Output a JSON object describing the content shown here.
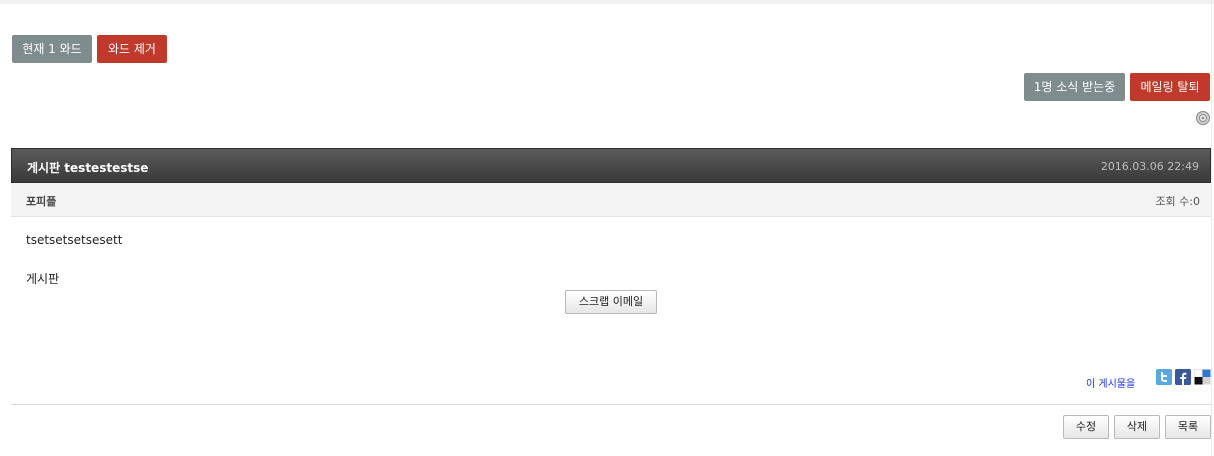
{
  "wad": {
    "count_label": "현재 1 와드",
    "remove_label": "와드 제거"
  },
  "mailing": {
    "subscribers_label": "1명 소식 받는중",
    "unsubscribe_label": "메일링 탈퇴"
  },
  "post": {
    "title": "게시판 testestestse",
    "date": "2016.03.06 22:49",
    "category": "포피플",
    "views": "조회 수:0",
    "body_lines": [
      "tsetsetsetsesett",
      "게시판"
    ],
    "scrap_email_label": "스크랩 이메일"
  },
  "share": {
    "label": "이 게시물을",
    "icons": [
      "twitter-icon",
      "facebook-icon",
      "delicious-icon"
    ]
  },
  "actions": {
    "edit_label": "수정",
    "delete_label": "삭제",
    "list_label": "목록"
  },
  "colors": {
    "gray_button": "#7f8c8d",
    "red_button": "#c0392b",
    "header_dark": "#474747",
    "link_blue": "#1a35d4"
  }
}
